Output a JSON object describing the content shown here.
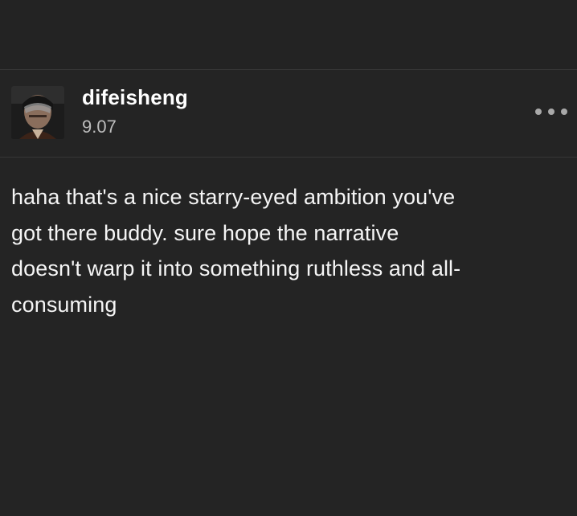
{
  "post": {
    "author": {
      "username": "difeisheng",
      "avatar_icon": "avatar-portrait-icon"
    },
    "date": "9.07",
    "body_lines": [
      "haha that's a nice starry-eyed ambition you've",
      "got there buddy. sure hope the narrative",
      "doesn't warp it into something ruthless and all-",
      "consuming"
    ],
    "more_icon": "more-options-icon"
  },
  "colors": {
    "background": "#242424",
    "divider": "#363636",
    "text": "#f5f5f5",
    "muted": "#bdbdbd"
  }
}
